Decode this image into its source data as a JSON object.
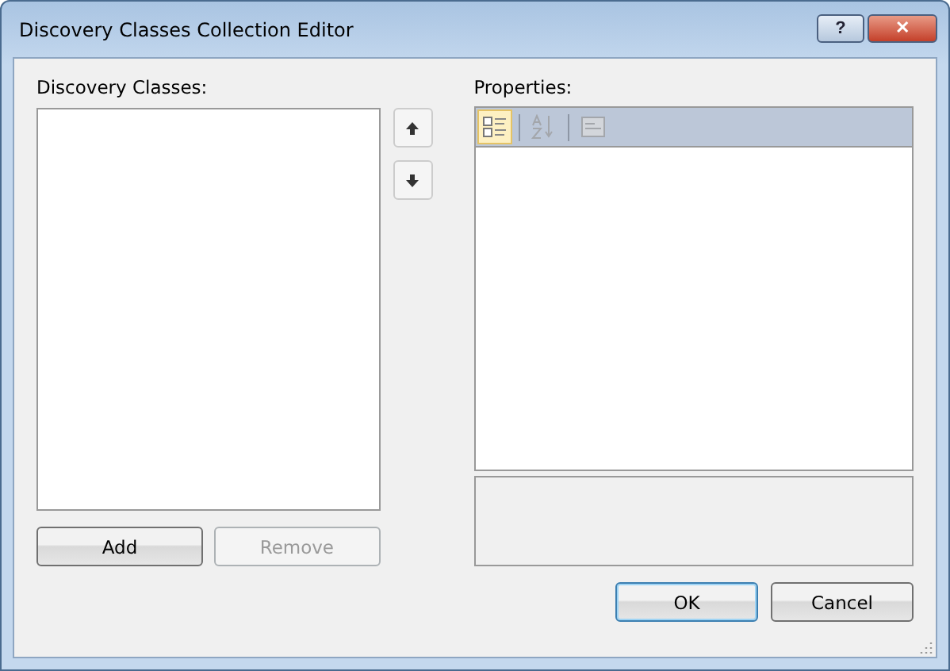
{
  "window": {
    "title": "Discovery Classes Collection Editor",
    "help_button": "?",
    "close_button": "✕"
  },
  "members": {
    "label": "Discovery Classes:"
  },
  "order_buttons": [
    {
      "kind": "up",
      "disabled": false
    },
    {
      "kind": "down",
      "disabled": false
    }
  ],
  "properties": {
    "label": "Properties:",
    "toolbar": [
      {
        "kind": "categorized",
        "selected": true,
        "disabled": false
      },
      {
        "kind": "alphabetical",
        "selected": false,
        "disabled": true
      },
      {
        "kind": "pages",
        "selected": false,
        "disabled": true
      }
    ]
  },
  "list_buttons": [
    {
      "label": "Add",
      "disabled": false
    },
    {
      "label": "Remove",
      "disabled": true
    }
  ],
  "dialog_buttons": [
    {
      "label": "OK",
      "default": true
    },
    {
      "label": "Cancel",
      "default": false
    }
  ]
}
